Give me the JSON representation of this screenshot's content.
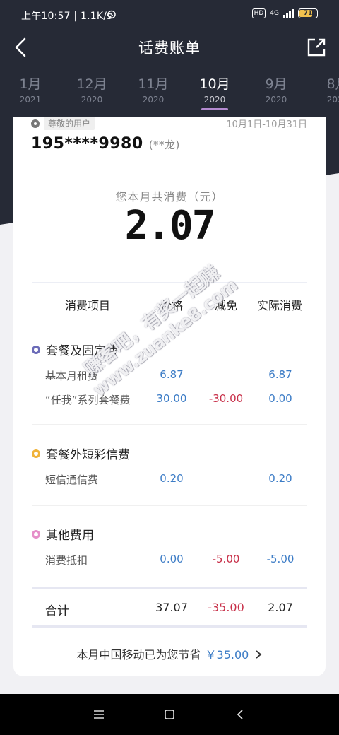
{
  "status_bar": {
    "time_speed": "上午10:57 | 1.1K/s",
    "hd": "HD",
    "network": "4G",
    "battery": "71"
  },
  "header": {
    "title": "话费账单"
  },
  "months": [
    {
      "m": "1月",
      "y": "2021"
    },
    {
      "m": "12月",
      "y": "2020"
    },
    {
      "m": "11月",
      "y": "2020"
    },
    {
      "m": "10月",
      "y": "2020"
    },
    {
      "m": "9月",
      "y": "2020"
    },
    {
      "m": "8月",
      "y": "2020"
    }
  ],
  "active_month_index": 3,
  "card": {
    "user_tag": "尊敬的用户",
    "period": "10月1日-10月31日",
    "phone": "195****9980",
    "name": "(**龙)",
    "total_label": "您本月共消费（元）",
    "total_value": "2.07"
  },
  "table": {
    "headers": {
      "item": "消费项目",
      "price": "价格",
      "discount": "减免",
      "actual": "实际消费"
    },
    "sections": [
      {
        "title": "套餐及固定费",
        "color": "#6b6bb8",
        "rows": [
          {
            "label": "基本月租费",
            "price": "6.87",
            "discount": "",
            "actual": "6.87"
          },
          {
            "label": "“任我”系列套餐费",
            "price": "30.00",
            "discount": "-30.00",
            "actual": "0.00"
          }
        ]
      },
      {
        "title": "套餐外短彩信费",
        "color": "#f0b33a",
        "rows": [
          {
            "label": "短信通信费",
            "price": "0.20",
            "discount": "",
            "actual": "0.20"
          }
        ]
      },
      {
        "title": "其他费用",
        "color": "#e58fc9",
        "rows": [
          {
            "label": "消费抵扣",
            "price": "0.00",
            "discount": "-5.00",
            "actual": "-5.00"
          }
        ]
      }
    ],
    "sum": {
      "label": "合计",
      "price": "37.07",
      "discount": "-35.00",
      "actual": "2.07"
    }
  },
  "savings": {
    "text": "本月中国移动已为您节省",
    "amount": "￥35.00"
  },
  "watermark": {
    "line1": "赚客吧，有奖一起赚",
    "line2": "www.zuanke8.com"
  },
  "colors": {
    "header_bg": "#262a36",
    "accent_purple": "#b48ad0",
    "blue": "#3c7cc6",
    "red": "#c8314a"
  }
}
